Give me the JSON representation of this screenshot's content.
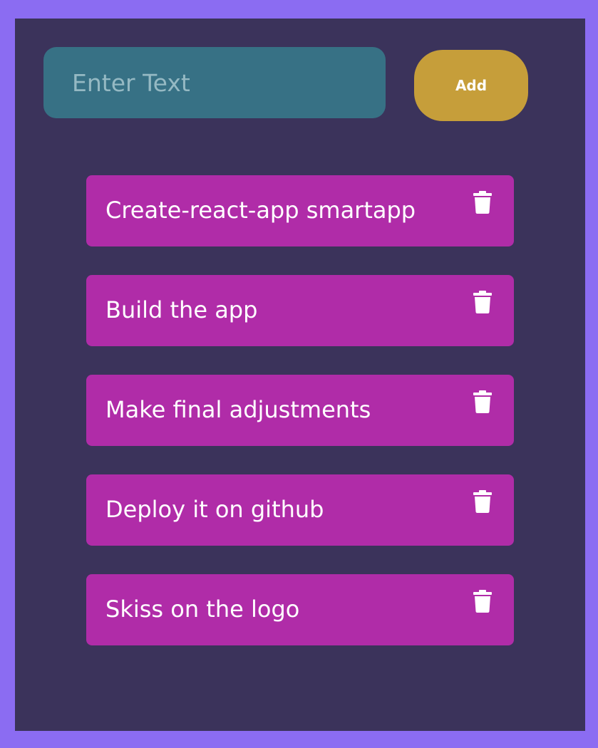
{
  "input": {
    "placeholder": "Enter Text",
    "value": ""
  },
  "add_button": {
    "label": "Add"
  },
  "todos": [
    {
      "text": "Create-react-app smartapp",
      "delete_icon": "trash-icon"
    },
    {
      "text": "Build the app",
      "delete_icon": "trash-icon"
    },
    {
      "text": "Make final adjustments",
      "delete_icon": "trash-icon"
    },
    {
      "text": "Deploy it on github",
      "delete_icon": "trash-icon"
    },
    {
      "text": "Skiss on the logo",
      "delete_icon": "trash-icon"
    }
  ],
  "colors": {
    "outer_background": "#8b6cf2",
    "panel_background": "#3b335b",
    "input_background": "#377185",
    "add_button_background": "#c69e3a",
    "todo_item_background": "#b02ca8"
  }
}
